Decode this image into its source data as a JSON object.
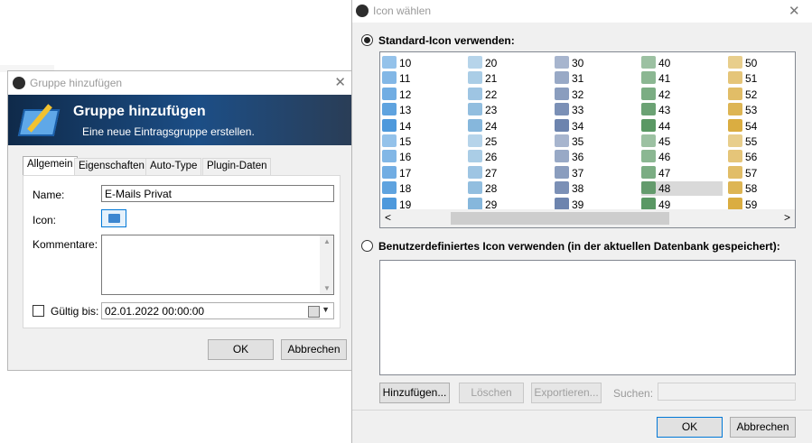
{
  "group_dialog": {
    "title": "Gruppe hinzufügen",
    "banner_title": "Gruppe hinzufügen",
    "banner_subtitle": "Eine neue Eintragsgruppe erstellen.",
    "tabs": [
      "Allgemein",
      "Eigenschaften",
      "Auto-Type",
      "Plugin-Daten"
    ],
    "name_label": "Name:",
    "name_value": "E-Mails Privat",
    "icon_label": "Icon:",
    "comment_label": "Kommentare:",
    "valid_label": "Gültig bis:",
    "valid_value": "02.01.2022 00:00:00",
    "ok": "OK",
    "cancel": "Abbrechen",
    "close_glyph": "✕"
  },
  "icon_dialog": {
    "title": "Icon wählen",
    "close_glyph": "✕",
    "standard_label": "Standard-Icon verwenden:",
    "custom_label": "Benutzerdefiniertes Icon verwenden (in der aktuellen Datenbank gespeichert):",
    "selected": "48",
    "columns": [
      [
        "10",
        "11",
        "12",
        "13",
        "14",
        "15",
        "16",
        "17",
        "18",
        "19"
      ],
      [
        "20",
        "21",
        "22",
        "23",
        "24",
        "25",
        "26",
        "27",
        "28",
        "29"
      ],
      [
        "30",
        "31",
        "32",
        "33",
        "34",
        "35",
        "36",
        "37",
        "38",
        "39"
      ],
      [
        "40",
        "41",
        "42",
        "43",
        "44",
        "45",
        "46",
        "47",
        "48",
        "49"
      ],
      [
        "50",
        "51",
        "52",
        "53",
        "54",
        "55",
        "56",
        "57",
        "58",
        "59"
      ]
    ],
    "icon_colors": {
      "col0": "#3c8fd8",
      "col1": "#7ab0d8",
      "col2": "#5e78a6",
      "col3": "#4a8e55",
      "col4": "#d6a52e"
    },
    "scroll_left": "<",
    "scroll_right": ">",
    "buttons": {
      "add": "Hinzufügen...",
      "delete": "Löschen",
      "export": "Exportieren...",
      "search_label": "Suchen:"
    },
    "ok": "OK",
    "cancel": "Abbrechen"
  }
}
